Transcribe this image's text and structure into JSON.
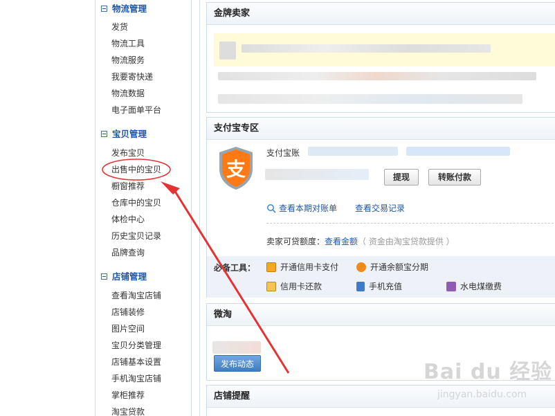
{
  "sidebar": {
    "groups": [
      {
        "title": "物流管理",
        "items": [
          "发货",
          "物流工具",
          "物流服务",
          "我要寄快递",
          "物流数据",
          "电子面单平台"
        ]
      },
      {
        "title": "宝贝管理",
        "items": [
          "发布宝贝",
          "出售中的宝贝",
          "橱窗推荐",
          "仓库中的宝贝",
          "体检中心",
          "历史宝贝记录",
          "品牌查询"
        ]
      },
      {
        "title": "店铺管理",
        "items": [
          "查看淘宝店铺",
          "店铺装修",
          "图片空间",
          "宝贝分类管理",
          "店铺基本设置",
          "手机淘宝店铺",
          "掌柜推荐",
          "淘宝贷款"
        ]
      }
    ]
  },
  "panels": {
    "gold": {
      "title": "金牌卖家"
    },
    "alipay": {
      "title": "支付宝专区",
      "account_label": "支付宝账",
      "withdraw_btn": "提现",
      "transfer_btn": "转账付款",
      "view_statement": "查看本期对账单",
      "view_transactions": "查看交易记录",
      "credit_label": "卖家可贷额度：",
      "credit_link": "查看金额",
      "credit_note": "（ 资金由淘宝贷款提供 ）",
      "tools_label": "必备工具：",
      "tools": {
        "credit_card_pay": "开通信用卡支付",
        "yuebao": "开通余额宝分期",
        "credit_repay": "信用卡还款",
        "phone_topup": "手机充值",
        "utilities": "水电煤缴费"
      },
      "icon_glyph": "支",
      "colors": {
        "logo_orange": "#ff7a14",
        "link_blue": "#1f57a8"
      }
    },
    "weitao": {
      "title": "微淘",
      "publish_btn": "发布动态"
    },
    "shop_reminder": {
      "title": "店铺提醒"
    }
  },
  "watermark": {
    "main": "Bai du 经验",
    "sub": "jingyan.baidu.com"
  },
  "annotation": {
    "color": "#e53333"
  }
}
